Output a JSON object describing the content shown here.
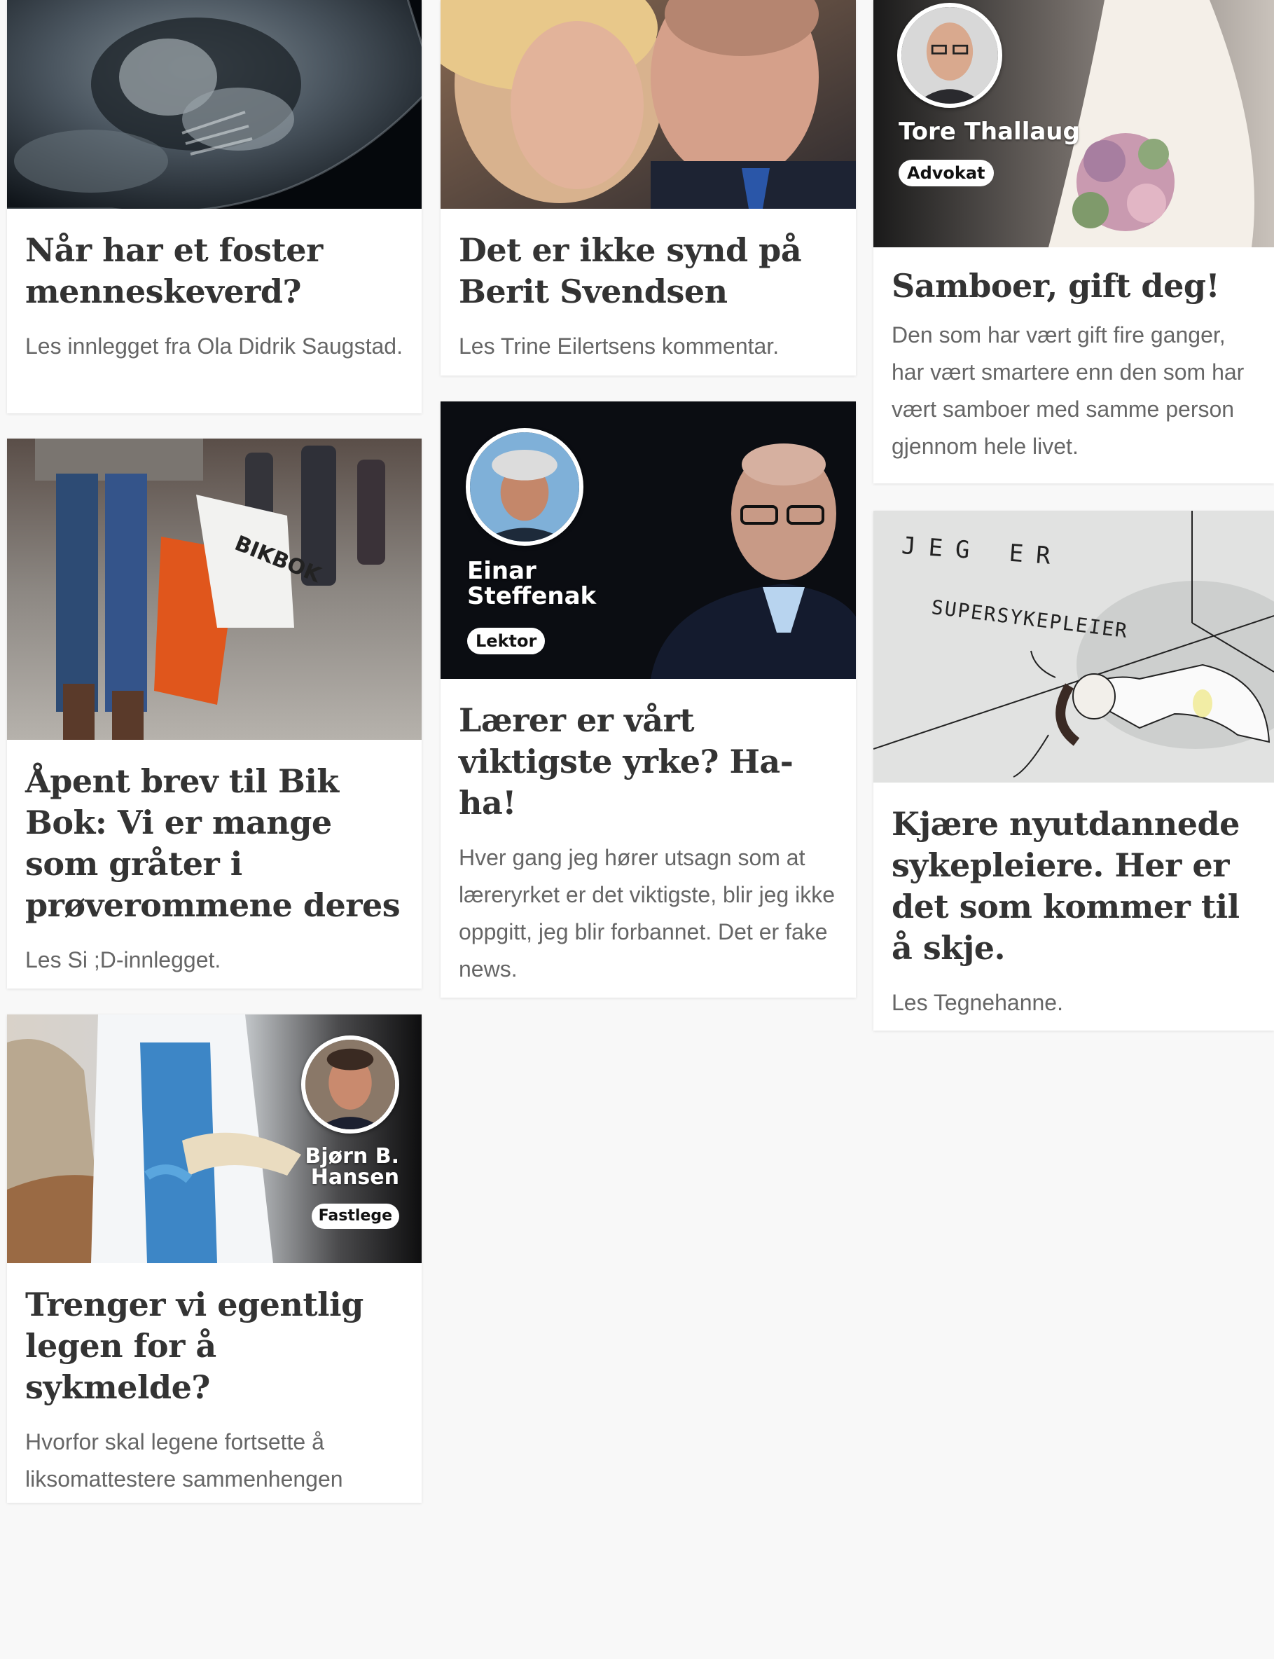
{
  "articles": [
    {
      "title": "Når har et foster menneskeverd?",
      "lead": "Les innlegget fra Ola Didrik Saugstad."
    },
    {
      "title": "Det er ikke synd på Berit Svendsen",
      "lead": "Les Trine Eilertsens kommentar."
    },
    {
      "title": "Samboer, gift deg!",
      "lead": "Den som har vært gift fire ganger, har vært smartere enn den som har vært samboer med samme person gjennom hele livet.",
      "author": "Tore Thallaug",
      "role": "Advokat"
    },
    {
      "title": "Åpent brev til Bik Bok: Vi er mange som gråter i prøverommene deres",
      "lead": "Les Si ;D-innlegget.",
      "bag_text": "BIKBOK"
    },
    {
      "title": "Lærer er vårt viktigste yrke? Ha-ha!",
      "lead": "Hver gang jeg hører utsagn som at læreryrket er det viktigste, blir jeg ikke oppgitt, jeg blir forbannet. Det er fake news.",
      "author": "Einar Steffenak",
      "role": "Lektor"
    },
    {
      "title": "Kjære nyutdannede sykepleiere. Her er det som kommer til å skje.",
      "lead": "Les Tegnehanne.",
      "drawing_text_1": "JEG ER",
      "drawing_text_2": "SUPERSYKEPLEIER"
    },
    {
      "title": "Trenger vi egentlig legen for å sykmelde?",
      "lead": "Hvorfor skal legene fortsette å liksomattestere sammenhengen mellom sykdom og jobbfravær?",
      "author": "Bjørn B. Hansen",
      "role": "Fastlege"
    }
  ]
}
